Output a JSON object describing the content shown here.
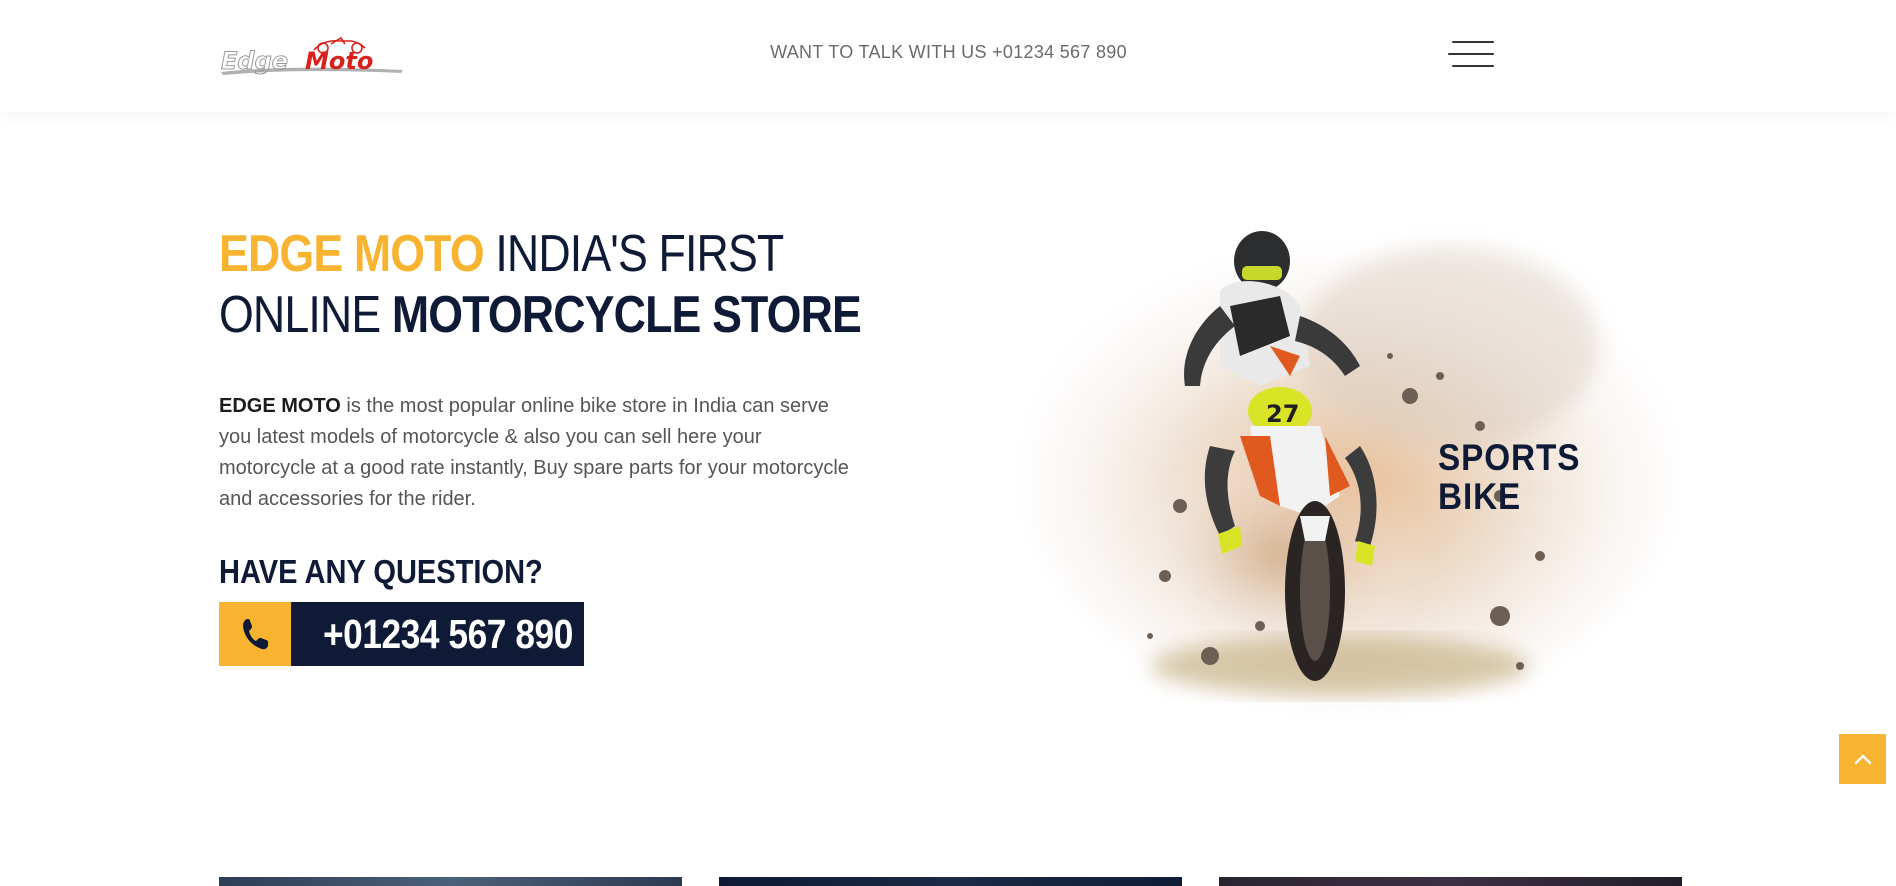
{
  "header": {
    "logo_text_left": "Edge",
    "logo_text_right": "Moto",
    "talk_text": "WANT TO TALK WITH US +01234 567 890",
    "menu_icon": "hamburger-menu-icon"
  },
  "hero": {
    "title_accent": "EDGE MOTO",
    "title_line1_rest": " INDIA'S FIRST",
    "title_line2_light": "ONLINE ",
    "title_line2_strong": "MOTORCYCLE STORE",
    "desc_brand": "EDGE MOTO",
    "desc_text": " is the most popular online bike store in India can serve you latest models of motorcycle & also you can sell here your motorcycle at a good rate instantly, Buy spare parts for your motorcycle and accessories for the rider.",
    "question": "HAVE ANY QUESTION?",
    "phone": "+01234 567 890",
    "phone_icon": "phone-icon",
    "image_label_line1": "SPORTS",
    "image_label_line2": "BIKE"
  },
  "scroll_top_icon": "chevron-up-icon",
  "colors": {
    "accent": "#f8b431",
    "navy": "#0e1a36",
    "logo_red": "#d9201c",
    "logo_gray": "#8a8a8a"
  }
}
